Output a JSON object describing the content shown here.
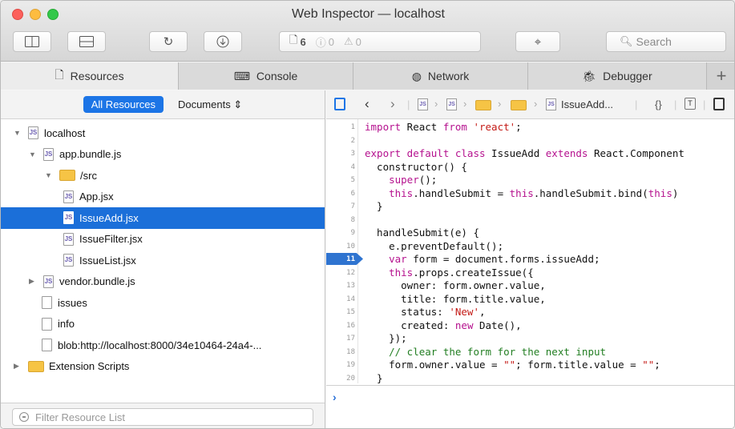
{
  "window": {
    "title": "Web Inspector — localhost"
  },
  "toolbar": {
    "resource_count": "6",
    "error_count": "0",
    "warning_count": "0",
    "search_placeholder": "Search"
  },
  "tabs": [
    {
      "label": "Resources",
      "active": true
    },
    {
      "label": "Console"
    },
    {
      "label": "Network"
    },
    {
      "label": "Debugger"
    }
  ],
  "sidebar": {
    "scope_selected": "All Resources",
    "scope_dropdown": "Documents",
    "filter_placeholder": "Filter Resource List",
    "tree": [
      {
        "label": "localhost",
        "icon": "page-js-icon",
        "depth": 0,
        "disclosure": "open"
      },
      {
        "label": "app.bundle.js",
        "icon": "js-file-icon",
        "depth": 1,
        "disclosure": "open"
      },
      {
        "label": "/src",
        "icon": "folder-icon",
        "depth": 2,
        "disclosure": "open"
      },
      {
        "label": "App.jsx",
        "icon": "js-file-icon",
        "depth": 3
      },
      {
        "label": "IssueAdd.jsx",
        "icon": "js-file-icon",
        "depth": 3,
        "selected": true
      },
      {
        "label": "IssueFilter.jsx",
        "icon": "js-file-icon",
        "depth": 3
      },
      {
        "label": "IssueList.jsx",
        "icon": "js-file-icon",
        "depth": 3
      },
      {
        "label": "vendor.bundle.js",
        "icon": "js-file-icon",
        "depth": 1,
        "disclosure": "closed"
      },
      {
        "label": "issues",
        "icon": "doc-icon",
        "depth": 1
      },
      {
        "label": "info",
        "icon": "doc-icon",
        "depth": 1
      },
      {
        "label": "blob:http://localhost:8000/34e10464-24a4-...",
        "icon": "doc-icon",
        "depth": 1
      },
      {
        "label": "Extension Scripts",
        "icon": "folder-icon",
        "depth": 0,
        "disclosure": "closed"
      }
    ]
  },
  "editor": {
    "breadcrumb_file": "IssueAdd...",
    "breakpoint_line": 11,
    "lines": [
      [
        [
          "k",
          "import"
        ],
        [
          "t",
          " React "
        ],
        [
          "k",
          "from"
        ],
        [
          "t",
          " "
        ],
        [
          "s",
          "'react'"
        ],
        [
          "t",
          ";"
        ]
      ],
      [],
      [
        [
          "k",
          "export default class"
        ],
        [
          "t",
          " IssueAdd "
        ],
        [
          "k",
          "extends"
        ],
        [
          "t",
          " React.Component"
        ]
      ],
      [
        [
          "t",
          "  constructor() {"
        ]
      ],
      [
        [
          "t",
          "    "
        ],
        [
          "k",
          "super"
        ],
        [
          "t",
          "();"
        ]
      ],
      [
        [
          "t",
          "    "
        ],
        [
          "k",
          "this"
        ],
        [
          "t",
          ".handleSubmit = "
        ],
        [
          "k",
          "this"
        ],
        [
          "t",
          ".handleSubmit.bind("
        ],
        [
          "k",
          "this"
        ],
        [
          "t",
          ")"
        ]
      ],
      [
        [
          "t",
          "  }"
        ]
      ],
      [],
      [
        [
          "t",
          "  handleSubmit(e) {"
        ]
      ],
      [
        [
          "t",
          "    e.preventDefault();"
        ]
      ],
      [
        [
          "t",
          "    "
        ],
        [
          "k",
          "var"
        ],
        [
          "t",
          " form = document.forms.issueAdd;"
        ]
      ],
      [
        [
          "t",
          "    "
        ],
        [
          "k",
          "this"
        ],
        [
          "t",
          ".props.createIssue({"
        ]
      ],
      [
        [
          "t",
          "      owner: form.owner.value,"
        ]
      ],
      [
        [
          "t",
          "      title: form.title.value,"
        ]
      ],
      [
        [
          "t",
          "      status: "
        ],
        [
          "s",
          "'New'"
        ],
        [
          "t",
          ","
        ]
      ],
      [
        [
          "t",
          "      created: "
        ],
        [
          "k",
          "new"
        ],
        [
          "t",
          " Date(),"
        ]
      ],
      [
        [
          "t",
          "    });"
        ]
      ],
      [
        [
          "c",
          "    // clear the form for the next input"
        ]
      ],
      [
        [
          "t",
          "    form.owner.value = "
        ],
        [
          "s",
          "\"\""
        ],
        [
          "t",
          "; form.title.value = "
        ],
        [
          "s",
          "\"\""
        ],
        [
          "t",
          ";"
        ]
      ],
      [
        [
          "t",
          "  }"
        ]
      ]
    ]
  },
  "console": {
    "prompt": "›"
  },
  "colors": {
    "accent": "#1c75e6",
    "selection": "#1b6fd9",
    "keyword": "#b5118e",
    "string": "#c41a16",
    "comment": "#227e22"
  }
}
